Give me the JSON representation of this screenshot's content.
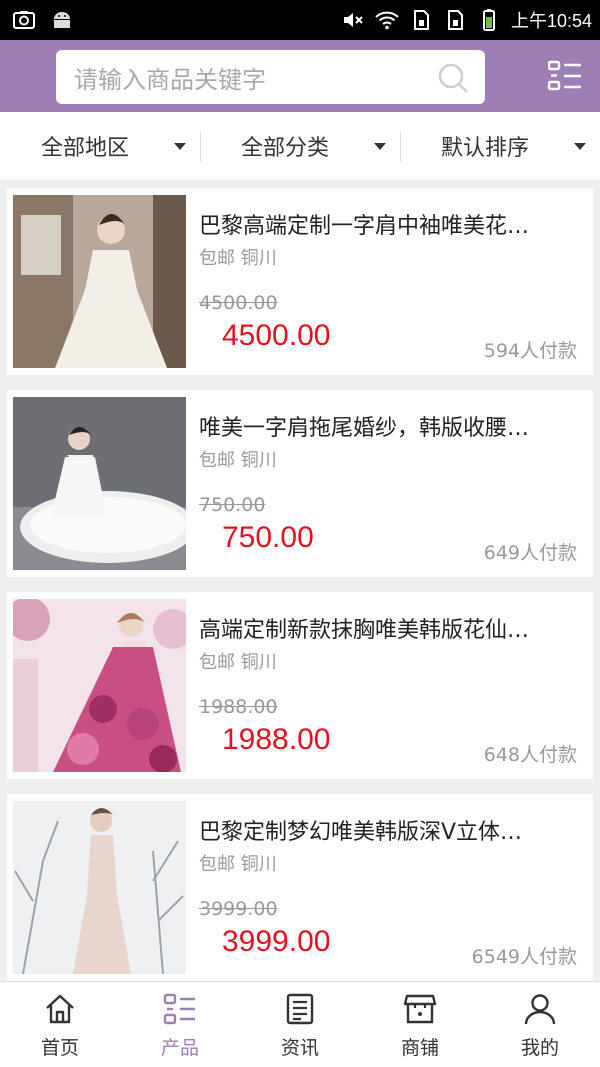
{
  "status_bar": {
    "time": "上午10:54"
  },
  "search": {
    "placeholder": "请输入商品关键字"
  },
  "filters": [
    {
      "label": "全部地区"
    },
    {
      "label": "全部分类"
    },
    {
      "label": "默认排序"
    }
  ],
  "products": [
    {
      "title": "巴黎高端定制一字肩中袖唯美花…",
      "shipping": "包邮",
      "location": "铜川",
      "old_price": "4500.00",
      "price": "4500.00",
      "sold": "594人付款"
    },
    {
      "title": "唯美一字肩拖尾婚纱，韩版收腰…",
      "shipping": "包邮",
      "location": "铜川",
      "old_price": "750.00",
      "price": "750.00",
      "sold": "649人付款"
    },
    {
      "title": "高端定制新款抹胸唯美韩版花仙…",
      "shipping": "包邮",
      "location": "铜川",
      "old_price": "1988.00",
      "price": "1988.00",
      "sold": "648人付款"
    },
    {
      "title": "巴黎定制梦幻唯美韩版深V立体…",
      "shipping": "包邮",
      "location": "铜川",
      "old_price": "3999.00",
      "price": "3999.00",
      "sold": "6549人付款"
    }
  ],
  "nav": [
    {
      "label": "首页",
      "icon": "home-icon",
      "active": false
    },
    {
      "label": "产品",
      "icon": "products-icon",
      "active": true
    },
    {
      "label": "资讯",
      "icon": "news-icon",
      "active": false
    },
    {
      "label": "商铺",
      "icon": "store-icon",
      "active": false
    },
    {
      "label": "我的",
      "icon": "user-icon",
      "active": false
    }
  ],
  "colors": {
    "accent": "#9d7fb6",
    "price": "#e0141e",
    "muted": "#999999"
  }
}
